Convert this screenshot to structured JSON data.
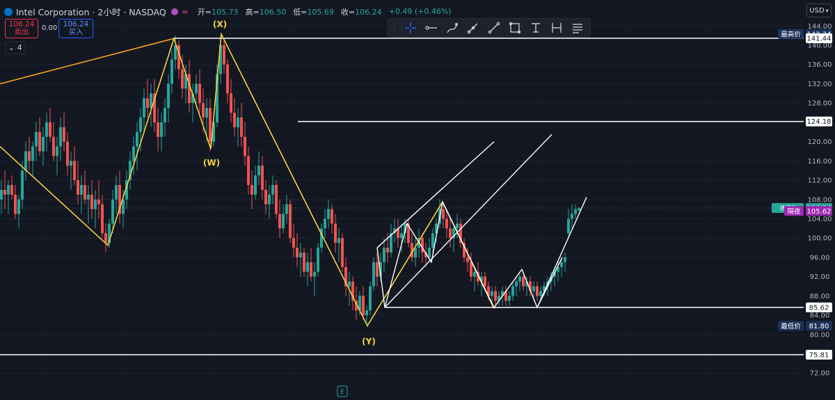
{
  "header": {
    "symbol": "Intel Corporation · 2小时 · NASDAQ",
    "open_label": "开",
    "open": "105.73",
    "high_label": "高",
    "high": "106.50",
    "low_label": "低",
    "low": "105.69",
    "close_label": "收",
    "close": "106.24",
    "change": "+0.49 (+0.46%)"
  },
  "trade": {
    "sell_price": "106.24",
    "sell_label": "卖出",
    "spread": "0.00",
    "buy_price": "106.24",
    "buy_label": "买入"
  },
  "indicators": {
    "collapse_count": "4"
  },
  "currency": "USD",
  "toolbar": {
    "tools": [
      {
        "name": "crosshair-tool-icon"
      },
      {
        "name": "horizontal-ray-tool-icon"
      },
      {
        "name": "brush-tool-icon"
      },
      {
        "name": "trend-angle-tool-icon"
      },
      {
        "name": "trend-line-tool-icon"
      },
      {
        "name": "rectangle-tool-icon"
      },
      {
        "name": "text-tool-icon"
      },
      {
        "name": "measure-tool-icon"
      },
      {
        "name": "more-tools-icon"
      }
    ]
  },
  "colors": {
    "background": "#131722",
    "up": "#26a69a",
    "down": "#ef5350",
    "wave_orange": "#f7a21b",
    "wave_yellow": "#f5d33b",
    "lines": "#ffffff",
    "axis_tag_bg": "#1c3258",
    "last_price_bg": "#26a69a",
    "afterhours_bg": "#9c27b0"
  },
  "chart_data": {
    "type": "candlestick",
    "symbol": "INTC",
    "yaxis": {
      "ticks": [
        "144.00",
        "140.00",
        "136.00",
        "132.00",
        "128.00",
        "124.00",
        "120.00",
        "116.00",
        "112.00",
        "108.00",
        "104.00",
        "100.00",
        "96.00",
        "92.00",
        "88.00",
        "84.00",
        "80.00",
        "76.00",
        "72.00"
      ],
      "range": [
        70,
        146
      ]
    },
    "price_tags": [
      {
        "label": "最高价",
        "value": "142.34",
        "style": "blue"
      },
      {
        "label": "",
        "value": "141.44",
        "style": "white"
      },
      {
        "label": "",
        "value": "124.18",
        "style": "white"
      },
      {
        "label": "INTC",
        "value": "106.24",
        "style": "green"
      },
      {
        "label": "隔夜",
        "value": "105.62",
        "style": "purple"
      },
      {
        "label": "",
        "value": "85.62",
        "style": "white"
      },
      {
        "label": "最低价",
        "value": "81.80",
        "style": "blue"
      },
      {
        "label": "",
        "value": "75.81",
        "style": "white"
      }
    ],
    "horizontal_levels": [
      141.44,
      124.18,
      85.62,
      75.81
    ],
    "wave_labels": [
      "(X)",
      "(W)",
      "(Y)"
    ],
    "earnings_marker": "E",
    "wave_orange": [
      [
        0,
        132
      ],
      [
        250,
        141.4
      ]
    ],
    "wave_yellow": [
      [
        0,
        119
      ],
      [
        155,
        98.5
      ],
      [
        250,
        141.4
      ],
      [
        303,
        118.5
      ],
      [
        318,
        142.3
      ],
      [
        528,
        81.8
      ],
      [
        636,
        107.5
      ],
      [
        710,
        85.4
      ]
    ],
    "white_swings": [
      [
        542,
        98
      ],
      [
        553,
        85.6
      ],
      [
        585,
        103
      ],
      [
        620,
        95
      ],
      [
        636,
        107.5
      ],
      [
        710,
        85.6
      ],
      [
        750,
        93.5
      ],
      [
        772,
        85.6
      ],
      [
        808,
        96
      ]
    ],
    "channel_lines": [
      [
        [
          542,
          98
        ],
        [
          710,
          120
        ]
      ],
      [
        [
          553,
          85.6
        ],
        [
          793,
          121.5
        ]
      ],
      [
        [
          772,
          85.6
        ],
        [
          843,
          108.5
        ]
      ]
    ],
    "candles": [
      [
        0,
        108,
        112,
        105,
        110
      ],
      [
        5,
        110,
        114,
        106,
        109
      ],
      [
        10,
        109,
        112,
        105,
        111
      ],
      [
        15,
        111,
        113,
        108,
        109
      ],
      [
        20,
        109,
        111,
        104,
        105
      ],
      [
        25,
        105,
        109,
        102,
        108
      ],
      [
        30,
        108,
        116,
        106,
        114
      ],
      [
        35,
        114,
        120,
        112,
        118
      ],
      [
        40,
        118,
        121,
        114,
        116
      ],
      [
        45,
        116,
        120,
        113,
        119
      ],
      [
        50,
        119,
        124,
        116,
        122
      ],
      [
        55,
        122,
        125,
        117,
        118
      ],
      [
        60,
        118,
        123,
        115,
        121
      ],
      [
        65,
        121,
        126,
        118,
        124
      ],
      [
        70,
        124,
        127,
        120,
        121
      ],
      [
        75,
        121,
        124,
        116,
        117
      ],
      [
        80,
        117,
        121,
        113,
        119
      ],
      [
        85,
        119,
        125,
        116,
        123
      ],
      [
        90,
        123,
        126,
        118,
        120
      ],
      [
        95,
        120,
        122,
        113,
        115
      ],
      [
        100,
        115,
        118,
        110,
        116
      ],
      [
        105,
        116,
        119,
        111,
        112
      ],
      [
        110,
        112,
        116,
        107,
        109
      ],
      [
        115,
        109,
        113,
        105,
        111
      ],
      [
        120,
        111,
        114,
        107,
        108
      ],
      [
        125,
        108,
        111,
        103,
        109
      ],
      [
        130,
        109,
        112,
        104,
        106
      ],
      [
        135,
        106,
        110,
        102,
        108
      ],
      [
        140,
        108,
        112,
        104,
        107
      ],
      [
        145,
        107,
        109,
        100,
        101
      ],
      [
        150,
        101,
        103,
        97,
        99
      ],
      [
        155,
        99,
        104,
        98,
        103
      ],
      [
        160,
        103,
        110,
        101,
        108
      ],
      [
        165,
        108,
        113,
        105,
        111
      ],
      [
        170,
        111,
        114,
        103,
        105
      ],
      [
        175,
        105,
        110,
        102,
        108
      ],
      [
        180,
        108,
        114,
        106,
        112
      ],
      [
        185,
        112,
        118,
        110,
        116
      ],
      [
        190,
        116,
        121,
        113,
        119
      ],
      [
        195,
        119,
        124,
        114,
        122
      ],
      [
        200,
        122,
        127,
        118,
        125
      ],
      [
        205,
        125,
        131,
        122,
        129
      ],
      [
        210,
        129,
        133,
        125,
        127
      ],
      [
        215,
        127,
        132,
        123,
        130
      ],
      [
        220,
        130,
        133,
        122,
        124
      ],
      [
        225,
        124,
        127,
        118,
        121
      ],
      [
        230,
        121,
        126,
        118,
        124
      ],
      [
        235,
        124,
        129,
        121,
        127
      ],
      [
        240,
        127,
        134,
        124,
        132
      ],
      [
        245,
        132,
        139,
        130,
        137
      ],
      [
        250,
        137,
        142,
        135,
        140
      ],
      [
        255,
        140,
        141,
        133,
        135
      ],
      [
        260,
        135,
        138,
        129,
        131
      ],
      [
        265,
        131,
        136,
        128,
        134
      ],
      [
        270,
        134,
        137,
        126,
        128
      ],
      [
        275,
        128,
        132,
        124,
        130
      ],
      [
        280,
        130,
        134,
        127,
        132
      ],
      [
        285,
        132,
        135,
        126,
        128
      ],
      [
        290,
        128,
        131,
        122,
        125
      ],
      [
        295,
        125,
        129,
        120,
        127
      ],
      [
        300,
        127,
        129,
        118,
        120
      ],
      [
        305,
        120,
        126,
        119,
        124
      ],
      [
        310,
        124,
        136,
        123,
        134
      ],
      [
        315,
        134,
        142,
        132,
        140
      ],
      [
        320,
        140,
        141,
        134,
        136
      ],
      [
        325,
        136,
        137,
        128,
        130
      ],
      [
        330,
        130,
        133,
        124,
        126
      ],
      [
        335,
        126,
        129,
        121,
        123
      ],
      [
        340,
        123,
        127,
        119,
        125
      ],
      [
        345,
        125,
        128,
        119,
        121
      ],
      [
        350,
        121,
        124,
        115,
        117
      ],
      [
        355,
        117,
        119,
        109,
        111
      ],
      [
        360,
        111,
        114,
        106,
        109
      ],
      [
        365,
        109,
        115,
        108,
        113
      ],
      [
        370,
        113,
        118,
        111,
        115
      ],
      [
        375,
        115,
        117,
        108,
        110
      ],
      [
        380,
        110,
        112,
        105,
        107
      ],
      [
        385,
        107,
        111,
        104,
        109
      ],
      [
        390,
        109,
        113,
        107,
        111
      ],
      [
        395,
        111,
        112,
        104,
        105
      ],
      [
        400,
        105,
        108,
        100,
        102
      ],
      [
        405,
        102,
        107,
        101,
        105
      ],
      [
        410,
        105,
        109,
        103,
        107
      ],
      [
        415,
        107,
        108,
        99,
        100
      ],
      [
        420,
        100,
        103,
        96,
        98
      ],
      [
        425,
        98,
        101,
        94,
        96
      ],
      [
        430,
        96,
        99,
        92,
        97
      ],
      [
        435,
        97,
        98,
        92,
        93
      ],
      [
        440,
        93,
        97,
        90,
        95
      ],
      [
        445,
        95,
        98,
        91,
        92
      ],
      [
        450,
        92,
        95,
        88,
        93
      ],
      [
        455,
        93,
        99,
        92,
        98
      ],
      [
        460,
        98,
        103,
        97,
        102
      ],
      [
        465,
        102,
        106,
        100,
        104
      ],
      [
        470,
        104,
        108,
        102,
        106
      ],
      [
        475,
        106,
        107,
        101,
        103
      ],
      [
        480,
        103,
        105,
        97,
        99
      ],
      [
        485,
        99,
        102,
        95,
        100
      ],
      [
        490,
        100,
        101,
        93,
        94
      ],
      [
        495,
        94,
        96,
        88,
        90
      ],
      [
        500,
        90,
        93,
        86,
        91
      ],
      [
        505,
        91,
        92,
        85,
        87
      ],
      [
        510,
        87,
        90,
        83,
        85
      ],
      [
        515,
        85,
        89,
        84,
        88
      ],
      [
        520,
        88,
        90,
        83,
        84
      ],
      [
        525,
        84,
        86,
        81.8,
        85
      ],
      [
        530,
        85,
        91,
        84,
        90
      ],
      [
        535,
        90,
        96,
        89,
        95
      ],
      [
        540,
        95,
        97,
        90,
        92
      ],
      [
        545,
        92,
        97,
        91,
        95
      ],
      [
        550,
        95,
        100,
        93,
        98
      ],
      [
        555,
        98,
        101,
        95,
        97
      ],
      [
        560,
        97,
        103,
        96,
        101
      ],
      [
        565,
        101,
        104,
        99,
        102
      ],
      [
        570,
        102,
        104,
        98,
        100
      ],
      [
        575,
        100,
        103,
        97,
        101
      ],
      [
        580,
        101,
        104,
        99,
        103
      ],
      [
        585,
        103,
        104,
        98,
        99
      ],
      [
        590,
        99,
        101,
        95,
        96
      ],
      [
        595,
        96,
        100,
        94,
        98
      ],
      [
        600,
        98,
        102,
        96,
        100
      ],
      [
        605,
        100,
        101,
        95,
        97
      ],
      [
        610,
        97,
        99,
        94,
        96
      ],
      [
        615,
        96,
        100,
        95,
        98
      ],
      [
        620,
        98,
        102,
        97,
        101
      ],
      [
        625,
        101,
        104,
        99,
        103
      ],
      [
        630,
        103,
        108,
        102,
        106
      ],
      [
        635,
        106,
        107.5,
        102,
        104
      ],
      [
        640,
        104,
        106,
        100,
        102
      ],
      [
        645,
        102,
        104,
        98,
        100
      ],
      [
        650,
        100,
        103,
        97,
        102
      ],
      [
        655,
        102,
        105,
        100,
        103
      ],
      [
        660,
        103,
        104,
        98,
        99
      ],
      [
        665,
        99,
        100,
        95,
        96
      ],
      [
        670,
        96,
        98,
        93,
        95
      ],
      [
        675,
        95,
        97,
        91,
        92
      ],
      [
        680,
        92,
        94,
        89,
        93
      ],
      [
        685,
        93,
        95,
        90,
        91
      ],
      [
        690,
        91,
        93,
        88,
        92
      ],
      [
        695,
        92,
        93,
        89,
        90
      ],
      [
        700,
        90,
        91,
        87,
        88
      ],
      [
        705,
        88,
        90,
        86,
        89
      ],
      [
        710,
        89,
        90,
        85.4,
        87
      ],
      [
        715,
        87,
        89,
        86,
        88
      ],
      [
        720,
        88,
        90,
        86,
        89
      ],
      [
        725,
        89,
        90,
        86,
        87
      ],
      [
        730,
        87,
        89,
        86,
        88
      ],
      [
        735,
        88,
        91,
        87,
        90
      ],
      [
        740,
        90,
        92,
        88,
        91
      ],
      [
        745,
        91,
        93,
        89,
        92
      ],
      [
        750,
        92,
        93,
        89,
        90
      ],
      [
        755,
        90,
        92,
        88,
        91
      ],
      [
        760,
        91,
        92,
        88,
        89
      ],
      [
        765,
        89,
        91,
        87,
        90
      ],
      [
        770,
        90,
        91,
        87,
        88
      ],
      [
        775,
        88,
        90,
        87,
        89
      ],
      [
        780,
        89,
        91,
        88,
        90
      ],
      [
        785,
        90,
        92,
        88,
        91
      ],
      [
        790,
        91,
        93,
        89,
        92
      ],
      [
        795,
        92,
        94,
        90,
        93
      ],
      [
        800,
        93,
        95,
        91,
        94
      ],
      [
        805,
        94,
        96,
        92,
        95
      ],
      [
        810,
        95,
        97,
        93,
        96
      ],
      [
        815,
        101,
        106,
        100,
        104
      ],
      [
        820,
        104,
        107,
        102,
        105
      ],
      [
        825,
        105,
        107,
        104,
        106
      ],
      [
        830,
        105.7,
        106.5,
        105.6,
        106.24
      ]
    ]
  }
}
